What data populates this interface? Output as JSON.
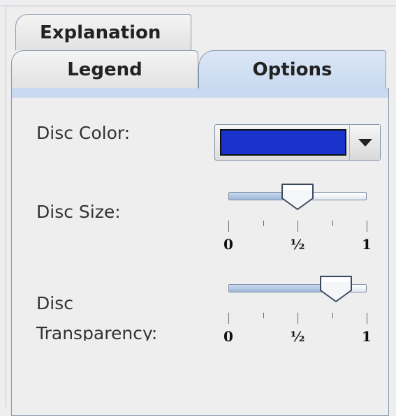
{
  "tabs": {
    "explanation": "Explanation",
    "legend": "Legend",
    "options": "Options",
    "selected": "Options"
  },
  "options": {
    "disc_color": {
      "label": "Disc Color:",
      "value": "#1a33cc"
    },
    "disc_size": {
      "label": "Disc Size:",
      "value": 0.5,
      "tick_labels": [
        "0",
        "½",
        "1"
      ]
    },
    "disc_transparency": {
      "label_line1": "Disc",
      "label_line2": "Transparency:",
      "value": 0.78,
      "tick_labels": [
        "0",
        "½",
        "1"
      ]
    }
  },
  "colors": {
    "selected_tab": "#c9daf0",
    "accent_border": "#8a98ad"
  }
}
